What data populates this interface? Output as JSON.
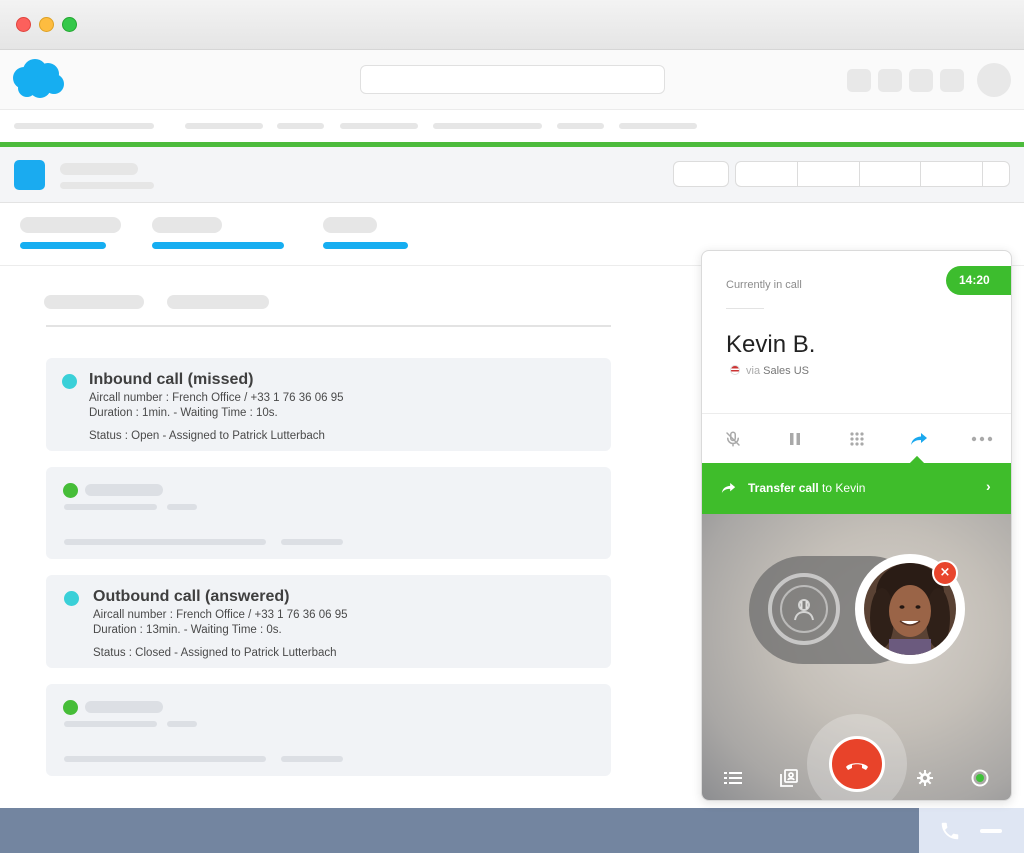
{
  "browser": {
    "window_controls": [
      "close",
      "minimize",
      "maximize"
    ]
  },
  "app": {
    "logo": "salesforce-cloud-logo",
    "accent": "#16aef1",
    "brand_green": "#4cbb3c"
  },
  "activity": {
    "cards": [
      {
        "dot_color": "#3ad0d8",
        "title": "Inbound call (missed)",
        "line1": "Aircall number : French Office / +33 1 76 36 06 95",
        "line2": "Duration : 1min.  -  Waiting Time : 10s.",
        "line3": "Status : Open   -   Assigned to Patrick Lutterbach"
      },
      {
        "dot_color": "#46bd38",
        "placeholder": true
      },
      {
        "dot_color": "#3ad0d8",
        "title": "Outbound call (answered)",
        "line1": "Aircall number : French Office / +33 1 76 36 06 95",
        "line2": "Duration : 13min.  -  Waiting Time : 0s.",
        "line3": "Status : Closed   -   Assigned to Patrick Lutterbach"
      },
      {
        "dot_color": "#46bd38",
        "placeholder": true
      }
    ]
  },
  "widget": {
    "status": "Currently in call",
    "timer": "14:20",
    "contact_name": "Kevin B.",
    "via_prefix": "via",
    "via_line": "Sales US",
    "controls": [
      "mute-icon",
      "pause-icon",
      "keypad-icon",
      "transfer-icon",
      "more-icon"
    ],
    "transfer": {
      "label_bold": "Transfer call",
      "label_rest": " to Kevin",
      "chevron": "›"
    },
    "remove_badge": "×",
    "bottom_icons": [
      "list-icon",
      "contacts-icon",
      "hangup-icon",
      "settings-icon",
      "availability-icon"
    ]
  }
}
